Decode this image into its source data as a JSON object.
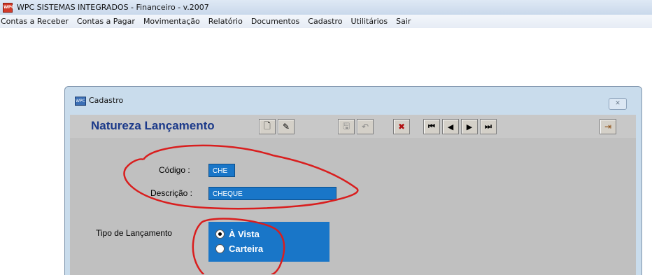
{
  "app": {
    "title": "WPC SISTEMAS INTEGRADOS - Financeiro - v.2007",
    "icon": "WPC"
  },
  "menu": [
    "Contas a Receber",
    "Contas a Pagar",
    "Movimentação",
    "Relatório",
    "Documentos",
    "Cadastro",
    "Utilitários",
    "Sair"
  ],
  "window": {
    "title": "Cadastro",
    "icon": "WPC",
    "close_label": "✕"
  },
  "form": {
    "title": "Natureza Lançamento",
    "toolbar": [
      {
        "name": "new-document-icon",
        "glyph": "🗋"
      },
      {
        "name": "edit-icon",
        "glyph": "✎"
      },
      {
        "name": "save-icon",
        "glyph": "🖫"
      },
      {
        "name": "undo-icon",
        "glyph": "↶"
      },
      {
        "name": "delete-icon",
        "glyph": "✖"
      },
      {
        "name": "first-record-icon",
        "glyph": "⏮"
      },
      {
        "name": "previous-record-icon",
        "glyph": "◀"
      },
      {
        "name": "next-record-icon",
        "glyph": "▶"
      },
      {
        "name": "last-record-icon",
        "glyph": "⏭"
      },
      {
        "name": "exit-icon",
        "glyph": "⇥"
      }
    ],
    "codigo_label": "Código :",
    "codigo_value": "CHE",
    "descricao_label": "Descrição :",
    "descricao_value": "CHEQUE",
    "tipo_label": "Tipo de Lançamento",
    "tipo_options": [
      "À Vista",
      "Carteira"
    ]
  },
  "colors": {
    "field_bg": "#1976c8",
    "form_title": "#1c3a8a",
    "annotation": "#d91e1e"
  }
}
